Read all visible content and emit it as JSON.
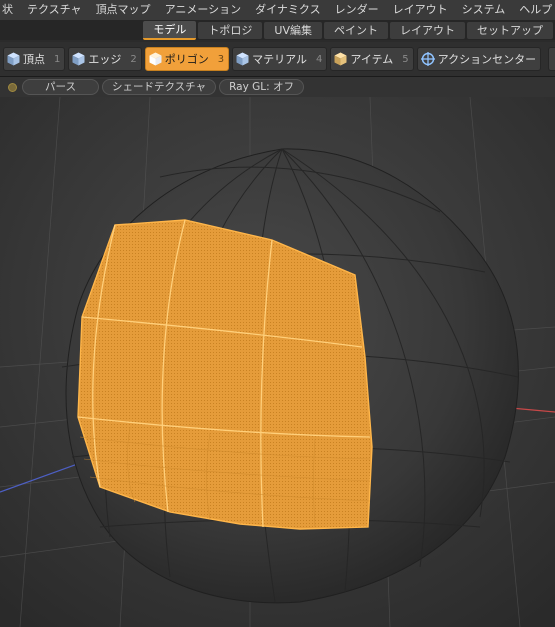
{
  "menu": {
    "items": [
      "状",
      "テクスチャ",
      "頂点マップ",
      "アニメーション",
      "ダイナミクス",
      "レンダー",
      "レイアウト",
      "システム",
      "ヘルプ"
    ]
  },
  "layout_tabs": {
    "items": [
      "モデル",
      "トポロジ",
      "UV編集",
      "ペイント",
      "レイアウト",
      "セットアップ"
    ],
    "active": "モデル"
  },
  "selection_modes": {
    "vertex": {
      "label": "頂点",
      "shortcut": "1"
    },
    "edge": {
      "label": "エッジ",
      "shortcut": "2"
    },
    "polygon": {
      "label": "ポリゴン",
      "shortcut": "3"
    },
    "material": {
      "label": "マテリアル",
      "shortcut": "4"
    },
    "item": {
      "label": "アイテム",
      "shortcut": "5"
    },
    "action_center": {
      "label": "アクションセンター"
    },
    "active": "ポリゴン"
  },
  "viewport_options": {
    "view_mode": "パース",
    "shading": "シェードテクスチャ",
    "raygl": "Ray GL: オフ"
  },
  "colors": {
    "accent": "#f1a03a",
    "selection": "#f2a43c",
    "mesh": "#3a3a3a",
    "background": "#2b2b2b"
  }
}
